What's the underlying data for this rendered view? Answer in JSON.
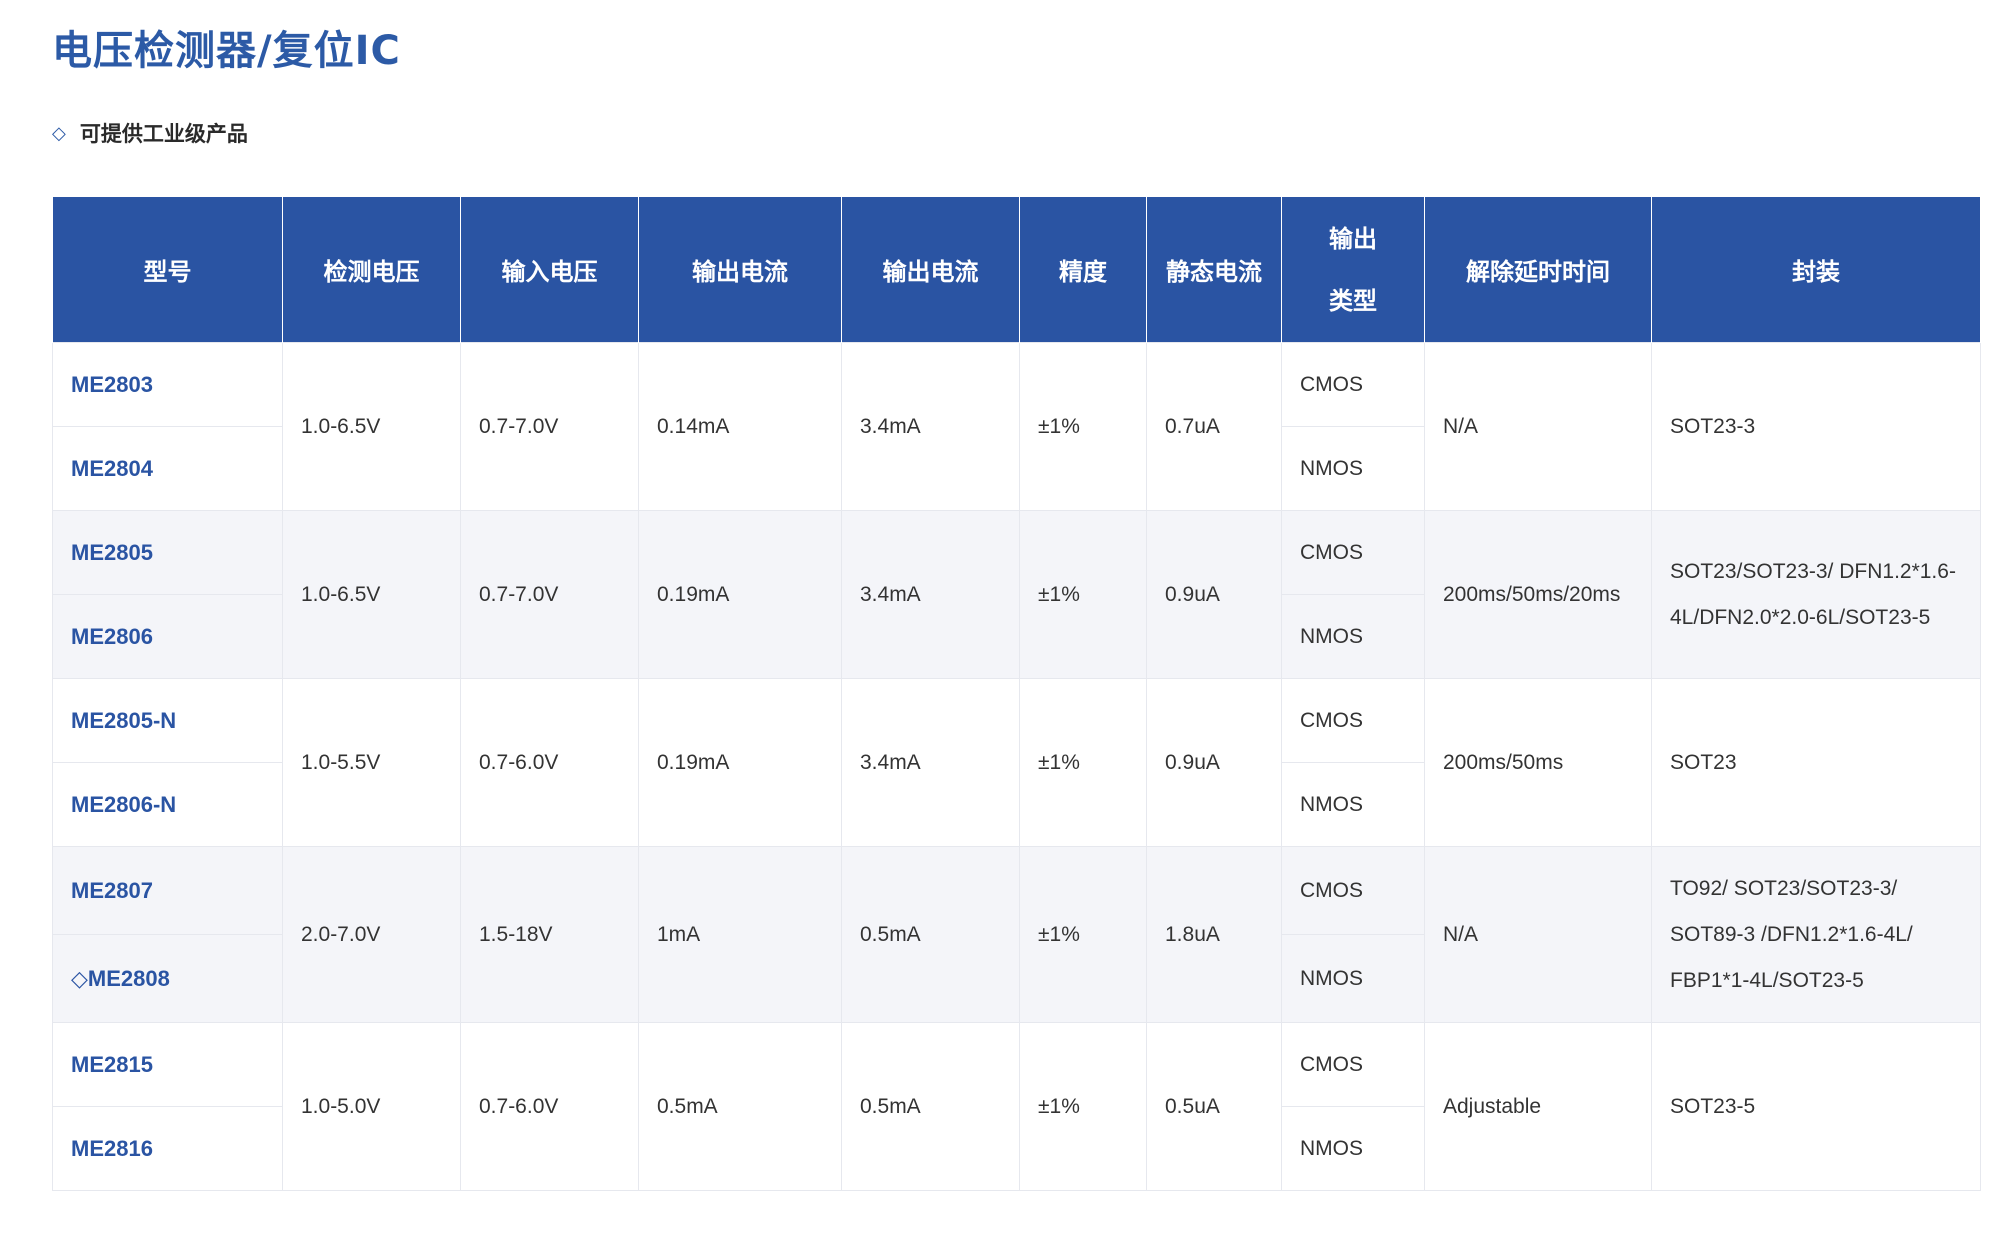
{
  "page": {
    "title": "电压检测器/复位IC",
    "note_icon": "diamond-icon",
    "note": "可提供工业级产品"
  },
  "table": {
    "headers": {
      "model": "型号",
      "detect_voltage": "检测电压",
      "input_voltage": "输入电压",
      "output_current_1": "输出电流",
      "output_current_2": "输出电流",
      "accuracy": "精度",
      "quiescent_current": "静态电流",
      "output_type_line1": "输出",
      "output_type_line2": "类型",
      "release_delay": "解除延时时间",
      "package": "封装"
    },
    "groups": [
      {
        "models": [
          "ME2803",
          "ME2804"
        ],
        "detect_voltage": "1.0-6.5V",
        "input_voltage": "0.7-7.0V",
        "output_current_1": "0.14mA",
        "output_current_2": "3.4mA",
        "accuracy": "±1%",
        "quiescent_current": "0.7uA",
        "types": [
          "CMOS",
          "NMOS"
        ],
        "release_delay": "N/A",
        "package": "SOT23-3"
      },
      {
        "models": [
          "ME2805",
          "ME2806"
        ],
        "detect_voltage": "1.0-6.5V",
        "input_voltage": "0.7-7.0V",
        "output_current_1": "0.19mA",
        "output_current_2": "3.4mA",
        "accuracy": "±1%",
        "quiescent_current": "0.9uA",
        "types": [
          "CMOS",
          "NMOS"
        ],
        "release_delay": "200ms/50ms/20ms",
        "package": "SOT23/SOT23-3/ DFN1.2*1.6-4L/DFN2.0*2.0-6L/SOT23-5"
      },
      {
        "models": [
          "ME2805-N",
          "ME2806-N"
        ],
        "detect_voltage": "1.0-5.5V",
        "input_voltage": "0.7-6.0V",
        "output_current_1": "0.19mA",
        "output_current_2": "3.4mA",
        "accuracy": "±1%",
        "quiescent_current": "0.9uA",
        "types": [
          "CMOS",
          "NMOS"
        ],
        "release_delay": "200ms/50ms",
        "package": "SOT23"
      },
      {
        "models": [
          "ME2807",
          "◇ME2808"
        ],
        "detect_voltage": "2.0-7.0V",
        "input_voltage": "1.5-18V",
        "output_current_1": "1mA",
        "output_current_2": "0.5mA",
        "accuracy": "±1%",
        "quiescent_current": "1.8uA",
        "types": [
          "CMOS",
          "NMOS"
        ],
        "release_delay": "N/A",
        "package": "TO92/ SOT23/SOT23-3/ SOT89-3 /DFN1.2*1.6-4L/ FBP1*1-4L/SOT23-5"
      },
      {
        "models": [
          "ME2815",
          "ME2816"
        ],
        "detect_voltage": "1.0-5.0V",
        "input_voltage": "0.7-6.0V",
        "output_current_1": "0.5mA",
        "output_current_2": "0.5mA",
        "accuracy": "±1%",
        "quiescent_current": "0.5uA",
        "types": [
          "CMOS",
          "NMOS"
        ],
        "release_delay": "Adjustable",
        "package": "SOT23-5"
      }
    ]
  }
}
